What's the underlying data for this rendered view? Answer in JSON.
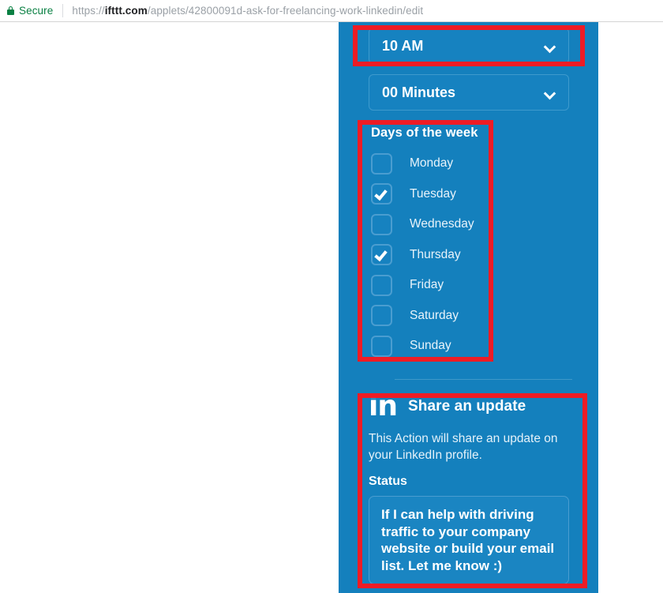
{
  "browser": {
    "security_label": "Secure",
    "lock_icon": "lock-icon",
    "url_scheme": "https://",
    "url_host": "ifttt.com",
    "url_path": "/applets/42800091d-ask-for-freelancing-work-linkedin/edit"
  },
  "panel": {
    "background_color": "#1480bd",
    "accent_color": "#4a9dd0",
    "annotation_color": "#ee1c25"
  },
  "schedule": {
    "hour_field": {
      "value": "10 AM",
      "chevron_icon": "chevron-down-icon"
    },
    "minute_field": {
      "value": "00 Minutes",
      "chevron_icon": "chevron-down-icon"
    }
  },
  "days": {
    "heading": "Days of the week",
    "items": [
      {
        "label": "Monday",
        "checked": false
      },
      {
        "label": "Tuesday",
        "checked": true
      },
      {
        "label": "Wednesday",
        "checked": false
      },
      {
        "label": "Thursday",
        "checked": true
      },
      {
        "label": "Friday",
        "checked": false
      },
      {
        "label": "Saturday",
        "checked": false
      },
      {
        "label": "Sunday",
        "checked": false
      }
    ]
  },
  "action": {
    "service_icon": "linkedin-icon",
    "service_glyph": "in",
    "title": "Share an update",
    "description": "This Action will share an update on your LinkedIn profile.",
    "status_label": "Status",
    "status_value": "If I can help with driving traffic to your company website or build your email list. Let me know :)"
  }
}
